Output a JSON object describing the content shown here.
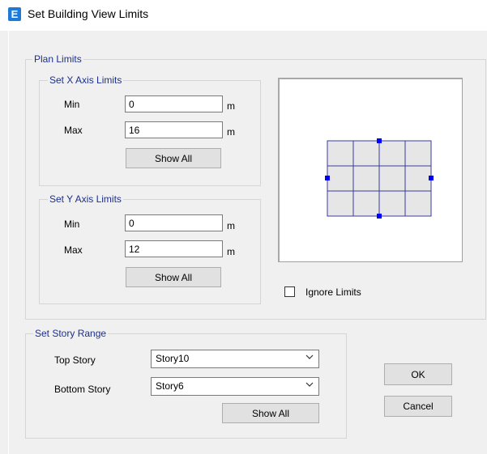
{
  "window": {
    "title": "Set Building View Limits",
    "app_icon_letter": "E"
  },
  "plan_limits": {
    "legend": "Plan Limits",
    "x_axis": {
      "legend": "Set X Axis Limits",
      "min_label": "Min",
      "min_value": "0",
      "min_unit": "m",
      "max_label": "Max",
      "max_value": "16",
      "max_unit": "m",
      "show_all_label": "Show All"
    },
    "y_axis": {
      "legend": "Set Y Axis Limits",
      "min_label": "Min",
      "min_value": "0",
      "min_unit": "m",
      "max_label": "Max",
      "max_value": "12",
      "max_unit": "m",
      "show_all_label": "Show All"
    },
    "ignore_limits_label": "Ignore Limits",
    "ignore_limits_checked": false
  },
  "story_range": {
    "legend": "Set Story Range",
    "top_story_label": "Top Story",
    "top_story_value": "Story10",
    "bottom_story_label": "Bottom Story",
    "bottom_story_value": "Story6",
    "show_all_label": "Show All"
  },
  "buttons": {
    "ok_label": "OK",
    "cancel_label": "Cancel"
  },
  "colors": {
    "accent": "#1c2f8c",
    "grid_fill": "#e6e6e6",
    "grid_line": "#3a3a9c",
    "handle": "#0000ff",
    "icon": "#1e7ad8"
  }
}
